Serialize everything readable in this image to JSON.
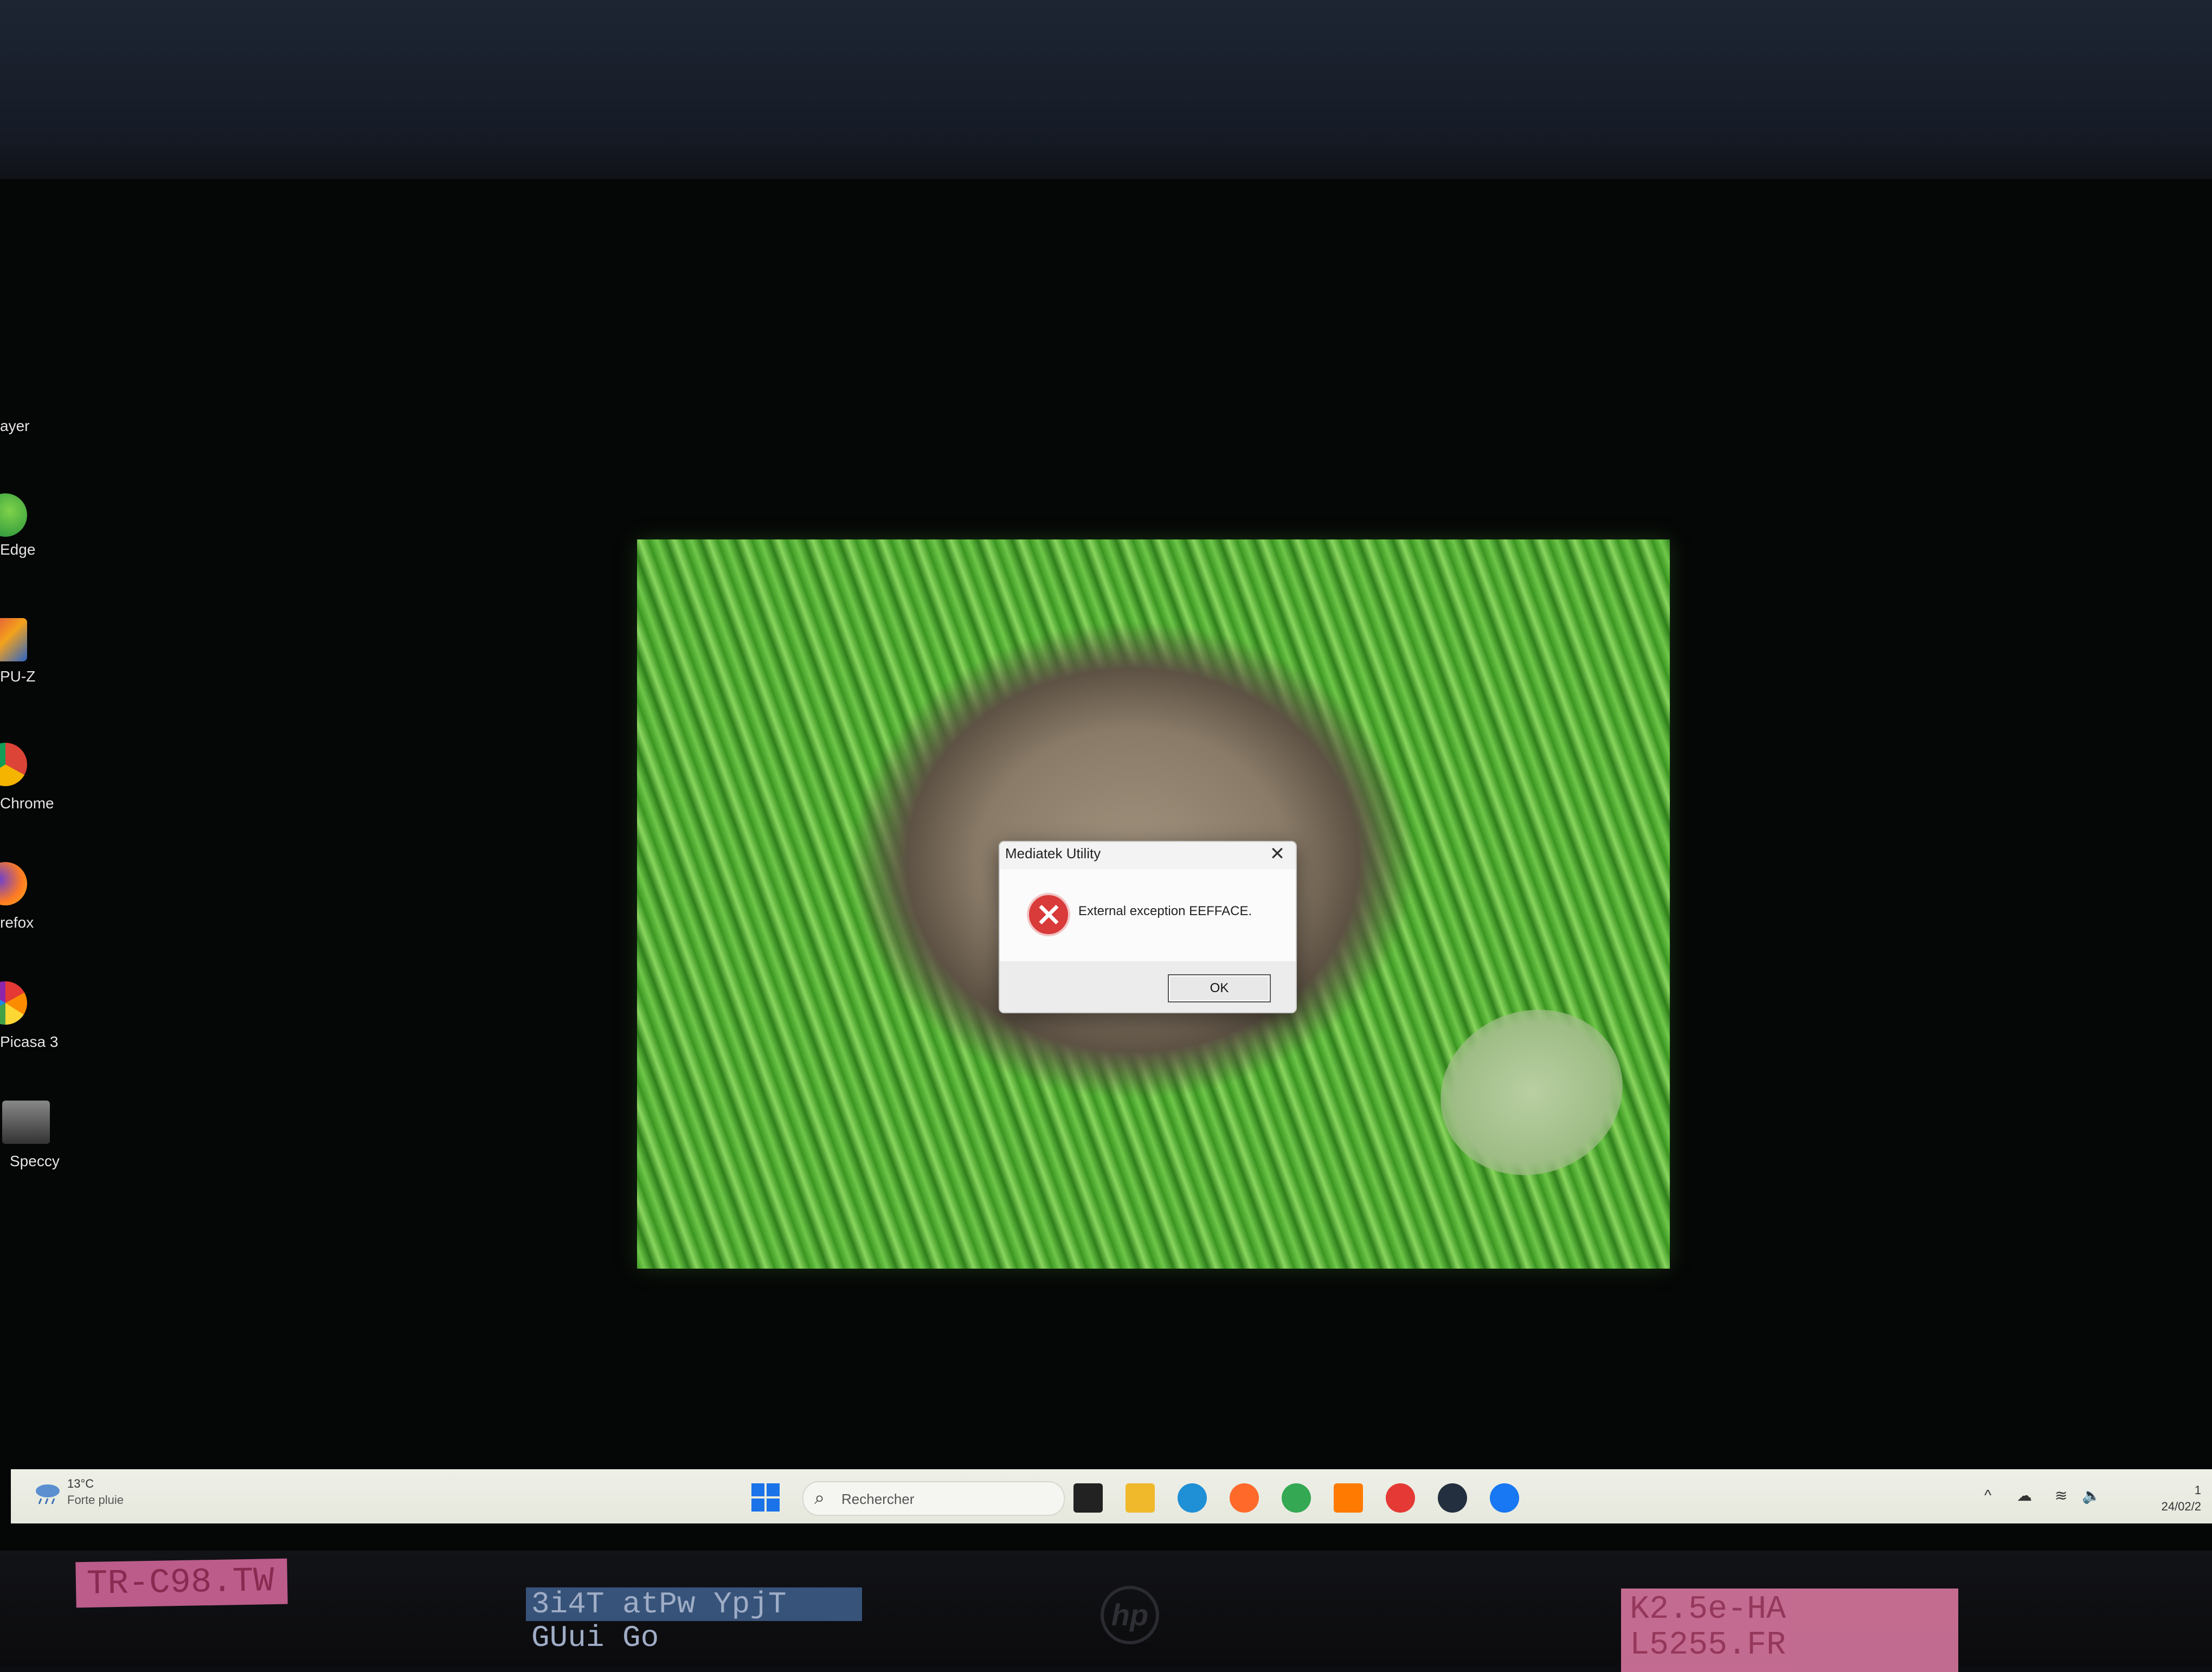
{
  "desktop": {
    "icons": [
      {
        "label": "ayer",
        "icon": "media-player-icon"
      },
      {
        "label": "Edge",
        "icon": "edge-icon"
      },
      {
        "label": "PU-Z",
        "icon": "cpuz-icon"
      },
      {
        "label": "Chrome",
        "icon": "chrome-icon"
      },
      {
        "label": "refox",
        "icon": "firefox-icon"
      },
      {
        "label": "Picasa 3",
        "icon": "picasa-icon"
      },
      {
        "label": "Speccy",
        "icon": "speccy-icon"
      }
    ]
  },
  "dialog": {
    "title": "Mediatek Utility",
    "close_glyph": "✕",
    "message": "External exception EEFFACE.",
    "ok_label": "OK",
    "icon": "error-icon"
  },
  "taskbar": {
    "weather": {
      "temp": "13°C",
      "desc": "Forte pluie",
      "icon": "rain-cloud-icon"
    },
    "search_placeholder": "Rechercher",
    "search_glyph": "⌕",
    "pinned": [
      {
        "name": "task-view-icon",
        "color": "#222222"
      },
      {
        "name": "file-explorer-icon",
        "color": "#f0b92c"
      },
      {
        "name": "edge-icon",
        "color": "#1f8fd6"
      },
      {
        "name": "firefox-icon",
        "color": "#ff6a2b"
      },
      {
        "name": "chrome-icon",
        "color": "#34a853"
      },
      {
        "name": "orange-app-icon",
        "color": "#ff7a00"
      },
      {
        "name": "youtube-icon",
        "color": "#e53935"
      },
      {
        "name": "amazon-icon",
        "color": "#232f3e"
      },
      {
        "name": "facebook-icon",
        "color": "#1877f2"
      }
    ],
    "tray": {
      "chevron": "^",
      "cloud": "☁",
      "wifi": "≋",
      "volume": "🔈",
      "time": "1",
      "date": "24/02/2"
    }
  },
  "bezel": {
    "sticker_left": "TR-C98.TW",
    "sticker_key": "3i4T atPw YpjT GUui Go",
    "sticker_right": "K2.5e-HA\nL5255.FR",
    "brand": "hp"
  }
}
